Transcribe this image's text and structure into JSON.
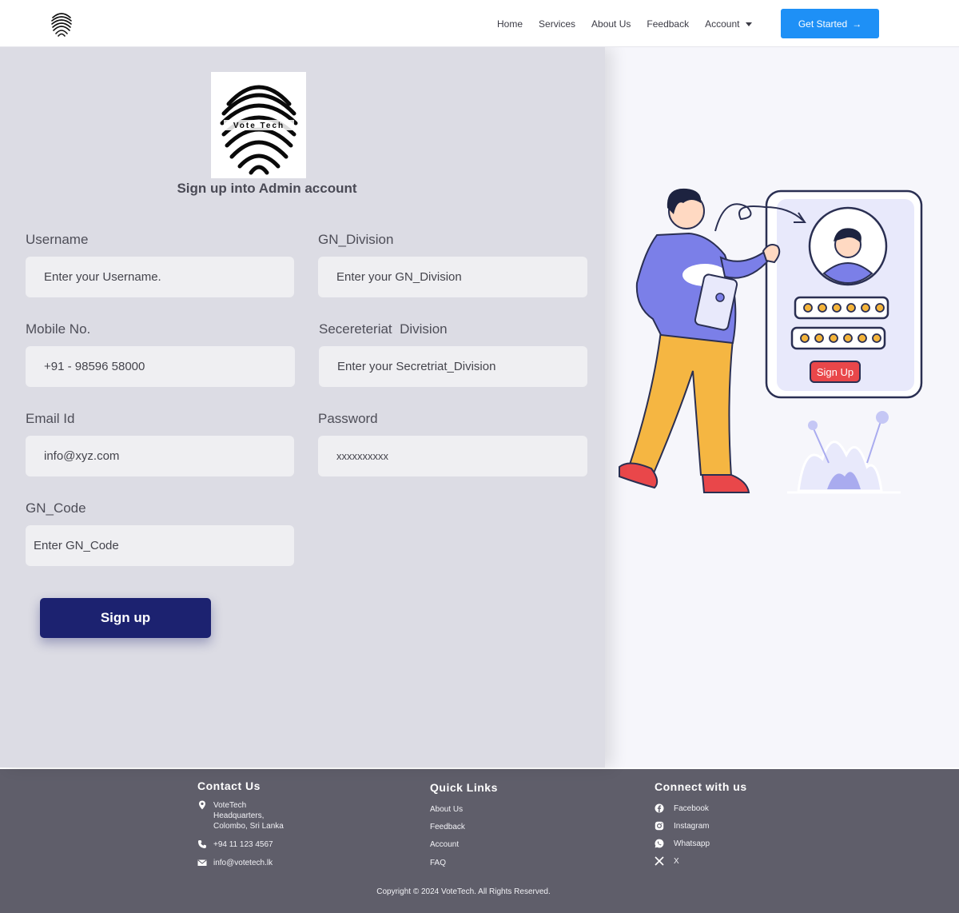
{
  "nav": {
    "links": [
      "Home",
      "Services",
      "About Us",
      "Feedback",
      "Account"
    ],
    "cta_label": "Get Started",
    "cta_arrow": "→",
    "accent_color": "#1e90f6"
  },
  "form": {
    "logo_text": "Vote Tech",
    "heading": "Sign up into Admin account",
    "fields": {
      "username": {
        "label": "Username",
        "placeholder": "Enter your Username."
      },
      "gn_division": {
        "label": "GN_Division",
        "placeholder": "Enter your GN_Division"
      },
      "mobile": {
        "label": "Mobile No.",
        "placeholder": "+91 - 98596 58000"
      },
      "secretariat": {
        "label": "Secereteriat  Division",
        "placeholder": "Enter your Secretriat_Division"
      },
      "email": {
        "label": "Email Id",
        "placeholder": "info@xyz.com"
      },
      "password": {
        "label": "Password",
        "placeholder": "xxxxxxxxxx"
      },
      "gn_code": {
        "label": "GN_Code",
        "placeholder": "Enter GN_Code"
      }
    },
    "submit_label": "Sign up",
    "submit_color": "#1c2270"
  },
  "illustration": {
    "button_label": "Sign Up"
  },
  "footer": {
    "contact": {
      "title": "Contact Us",
      "address_line1": "VoteTech",
      "address_line2": "Headquarters,",
      "address_line3": "Colombo, Sri Lanka",
      "phone": "+94 11 123 4567",
      "email": "info@votetech.lk"
    },
    "quick_links": {
      "title": "Quick Links",
      "items": [
        "About Us",
        "Feedback",
        "Account",
        "FAQ"
      ]
    },
    "connect": {
      "title": "Connect with us",
      "items": [
        "Facebook",
        "Instagram",
        "Whatsapp",
        "X"
      ]
    },
    "copyright": "Copyright © 2024 VoteTech. All Rights Reserved."
  }
}
